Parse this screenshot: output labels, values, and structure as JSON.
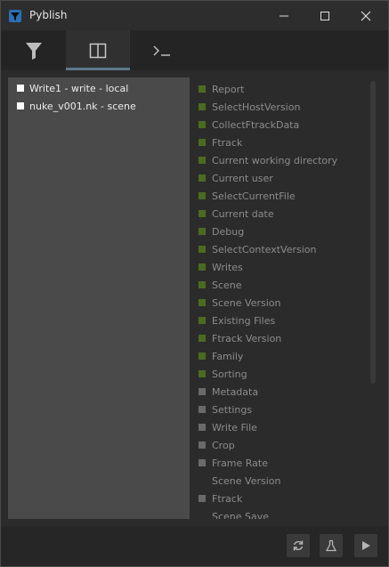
{
  "window": {
    "title": "Pyblish"
  },
  "tabs": [
    {
      "icon": "filter-icon"
    },
    {
      "icon": "layout-icon",
      "active": true
    },
    {
      "icon": "terminal-icon"
    }
  ],
  "instances": [
    {
      "label": "Write1 - write - local",
      "checked": true
    },
    {
      "label": "nuke_v001.nk - scene",
      "checked": true
    }
  ],
  "plugins": [
    {
      "label": "Report",
      "state": "green"
    },
    {
      "label": "SelectHostVersion",
      "state": "green"
    },
    {
      "label": "CollectFtrackData",
      "state": "green"
    },
    {
      "label": "Ftrack",
      "state": "green"
    },
    {
      "label": "Current working directory",
      "state": "green"
    },
    {
      "label": "Current user",
      "state": "green"
    },
    {
      "label": "SelectCurrentFile",
      "state": "green"
    },
    {
      "label": "Current date",
      "state": "green"
    },
    {
      "label": "Debug",
      "state": "green"
    },
    {
      "label": "SelectContextVersion",
      "state": "green"
    },
    {
      "label": "Writes",
      "state": "green"
    },
    {
      "label": "Scene",
      "state": "green"
    },
    {
      "label": "Scene Version",
      "state": "green"
    },
    {
      "label": "Existing Files",
      "state": "green"
    },
    {
      "label": "Ftrack Version",
      "state": "green"
    },
    {
      "label": "Family",
      "state": "green"
    },
    {
      "label": "Sorting",
      "state": "green"
    },
    {
      "label": "Metadata",
      "state": "grey"
    },
    {
      "label": "Settings",
      "state": "grey"
    },
    {
      "label": "Write File",
      "state": "grey"
    },
    {
      "label": "Crop",
      "state": "grey"
    },
    {
      "label": "Frame Rate",
      "state": "grey"
    },
    {
      "label": "Scene Version",
      "state": "none"
    },
    {
      "label": "Ftrack",
      "state": "grey"
    },
    {
      "label": "Scene Save",
      "state": "none"
    }
  ],
  "colors": {
    "green": "#4b6b1f",
    "grey": "#6a6a6a",
    "accent": "#5e7a8c"
  },
  "footer": {
    "buttons": [
      "refresh-icon",
      "flask-icon",
      "play-icon"
    ]
  }
}
